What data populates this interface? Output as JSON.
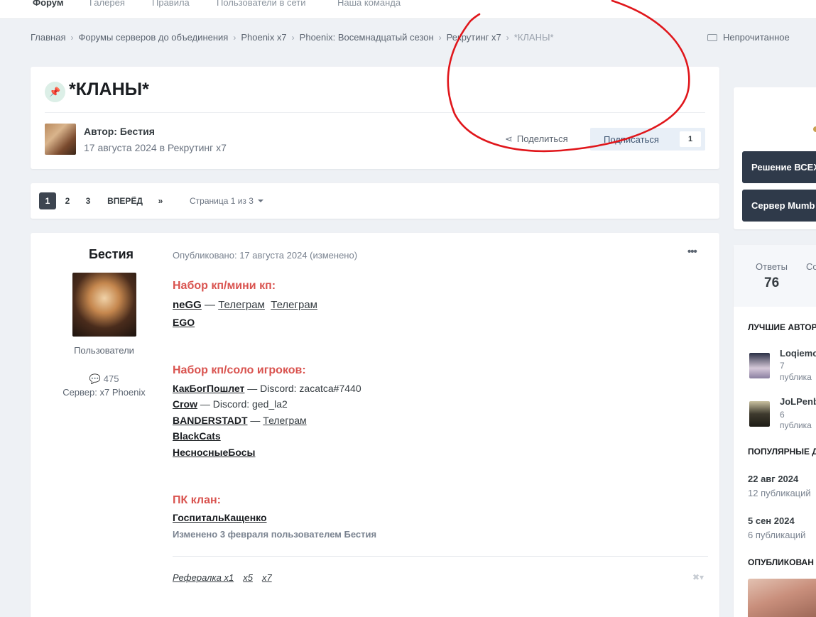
{
  "topnav": {
    "items": [
      "Форум",
      "Галерея",
      "Правила",
      "Пользователи в сети",
      "Наша команда"
    ]
  },
  "breadcrumb": {
    "items": [
      "Главная",
      "Форумы серверов до объединения",
      "Phoenix x7",
      "Phoenix: Восемнадцатый сезон",
      "Рекрутинг x7"
    ],
    "current": "*КЛАНЫ*",
    "unread": "Непрочитанное"
  },
  "topic": {
    "title": "*КЛАНЫ*",
    "author_line": "Автор: Бестия",
    "date_line": "17 августа 2024 в Рекрутинг x7",
    "share_label": "Поделиться",
    "follow_label": "Подписаться",
    "follow_count": "1"
  },
  "pagination": {
    "pages": [
      "1",
      "2",
      "3"
    ],
    "next": "ВПЕРЁД",
    "last": "»",
    "info": "Страница 1 из 3"
  },
  "post": {
    "author": "Бестия",
    "group": "Пользователи",
    "post_count": "475",
    "server": "Сервер: x7 Phoenix",
    "date": "Опубликовано: 17 августа 2024 (изменено)",
    "menu": "•••",
    "section1": {
      "title": "Набор кп/мини кп:",
      "clan1": "neGG",
      "dash1": " — ",
      "tg1": "Телеграм",
      "tg2": "Телеграм",
      "clan2": "EGO"
    },
    "section2": {
      "title": "Набор кп/соло игроков:",
      "r1_clan": "КакБогПошлет",
      "r1_rest": " —  Discord:  zacatca#7440",
      "r2_clan": "Crow",
      "r2_rest": " —  Discord: ged_la2",
      "r3_clan": "BANDERSTADT",
      "r3_dash": " — ",
      "r3_tg": "Телеграм",
      "r4_clan": "BlackCats",
      "r5_clan": "НесносныеБосы"
    },
    "section3": {
      "title": "ПК клан:",
      "clan": "ГоспитальКащенко"
    },
    "edited": "Изменено 3 февраля пользователем Бестия",
    "signature": [
      "Рефералка x1",
      "x5",
      "x7"
    ],
    "sig_close": "✖▾"
  },
  "sidebar": {
    "button1": "Решение ВСЕХ",
    "button2": "Сервер Mumb",
    "stats_label1": "Ответы",
    "stats_label2": "Со",
    "stats_value1": "76",
    "top_authors_title": "ЛУЧШИЕ АВТОР",
    "authors": [
      {
        "name": "Loqiemo",
        "count": "7",
        "unit": "публика"
      },
      {
        "name": "JoLPenb",
        "count": "6",
        "unit": "публика"
      }
    ],
    "popular_title": "ПОПУЛЯРНЫЕ Д",
    "popular": [
      {
        "date": "22 авг 2024",
        "count": "12 публикаций"
      },
      {
        "date": "5 сен 2024",
        "count": "6 публикаций"
      }
    ],
    "published_title": "ОПУБЛИКОВАН"
  },
  "colors": {
    "background": "#eef1f5",
    "accent_red": "#d9534f",
    "dark_button": "#2f3a4a",
    "annotation": "#e0161b"
  }
}
